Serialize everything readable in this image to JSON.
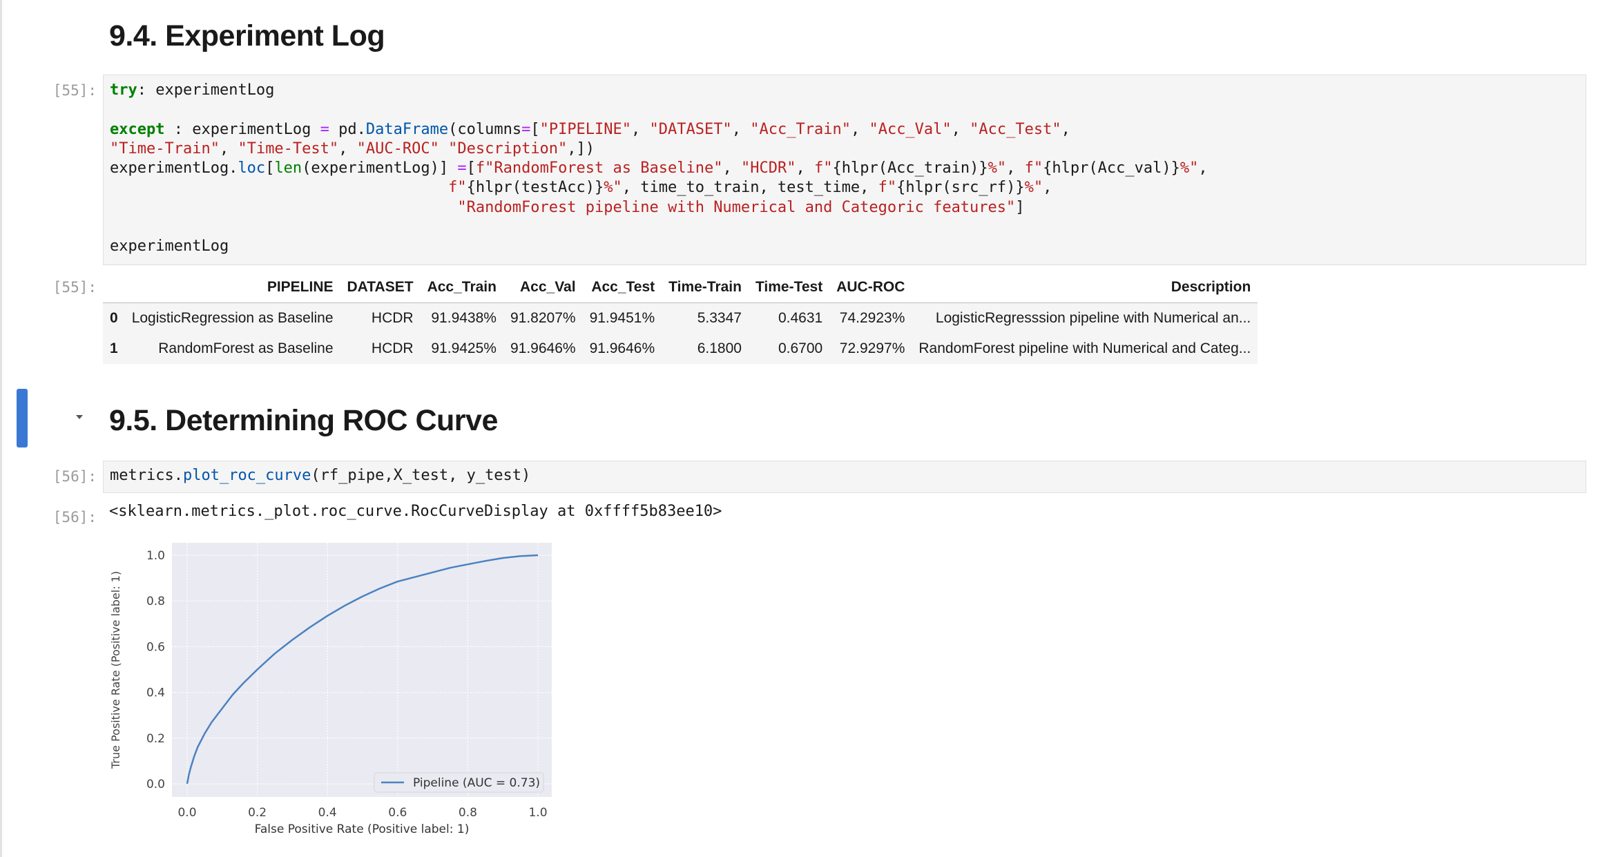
{
  "sections": {
    "experiment_log_heading": "9.4. Experiment Log",
    "roc_heading": "9.5. Determining ROC Curve"
  },
  "cells": {
    "cell55_prompt": "[55]:",
    "cell55_out_prompt": "[55]:",
    "cell56_prompt": "[56]:",
    "cell56_out_prompt": "[56]:",
    "cell56_output_text": "<sklearn.metrics._plot.roc_curve.RocCurveDisplay at 0xffff5b83ee10>"
  },
  "code55": {
    "l1_kw": "try",
    "l1_rest": ": experimentLog",
    "l3_kw": "except",
    "l3_a": " : experimentLog ",
    "l3_eq": "=",
    "l3_b": " pd.",
    "l3_fn": "DataFrame",
    "l3_c": "(columns",
    "l3_eq2": "=",
    "l3_d": "[",
    "l3_s1": "\"PIPELINE\"",
    "l3_e": ", ",
    "l3_s2": "\"DATASET\"",
    "l3_f": ", ",
    "l3_s3": "\"Acc_Train\"",
    "l3_g": ", ",
    "l3_s4": "\"Acc_Val\"",
    "l3_h": ", ",
    "l3_s5": "\"Acc_Test\"",
    "l3_i": ",",
    "l4_s1": "\"Time-Train\"",
    "l4_a": ", ",
    "l4_s2": "\"Time-Test\"",
    "l4_b": ", ",
    "l4_s3": "\"AUC-ROC\" \"Description\"",
    "l4_c": ",])",
    "l5_a": "experimentLog.",
    "l5_fn": "loc",
    "l5_b": "[",
    "l5_bi": "len",
    "l5_c": "(experimentLog)] ",
    "l5_eq": "=",
    "l5_d": "[",
    "l5_s1": "f\"RandomForest as Baseline\"",
    "l5_e": ", ",
    "l5_s2": "\"HCDR\"",
    "l5_f": ", ",
    "l5_s3": "f\"",
    "l5_g": "{hlpr(Acc_train)}",
    "l5_s4": "%\"",
    "l5_h": ", ",
    "l5_s5": "f\"",
    "l5_i": "{hlpr(Acc_val)}",
    "l5_s6": "%\"",
    "l5_j": ",",
    "l6_indent": "                                     ",
    "l6_s1": "f\"",
    "l6_a": "{hlpr(testAcc)}",
    "l6_s2": "%\"",
    "l6_b": ", time_to_train, test_time, ",
    "l6_s3": "f\"",
    "l6_c": "{hlpr(src_rf)}",
    "l6_s4": "%\"",
    "l6_d": ",",
    "l7_indent": "                                      ",
    "l7_s1": "\"RandomForest pipeline with Numerical and Categoric features\"",
    "l7_a": "]",
    "l9": "experimentLog"
  },
  "code56": {
    "a": "metrics.",
    "fn": "plot_roc_curve",
    "b": "(rf_pipe,X_test, y_test)"
  },
  "table": {
    "columns": [
      "",
      "PIPELINE",
      "DATASET",
      "Acc_Train",
      "Acc_Val",
      "Acc_Test",
      "Time-Train",
      "Time-Test",
      "AUC-ROC",
      "Description"
    ],
    "rows": [
      [
        "0",
        "LogisticRegression as Baseline",
        "HCDR",
        "91.9438%",
        "91.8207%",
        "91.9451%",
        "5.3347",
        "0.4631",
        "74.2923%",
        "LogisticRegresssion pipeline with Numerical an..."
      ],
      [
        "1",
        "RandomForest as Baseline",
        "HCDR",
        "91.9425%",
        "91.9646%",
        "91.9646%",
        "6.1800",
        "0.6700",
        "72.9297%",
        "RandomForest pipeline with Numerical and Categ..."
      ]
    ]
  },
  "chart_data": {
    "type": "line",
    "title": "",
    "xlabel": "False Positive Rate (Positive label: 1)",
    "ylabel": "True Positive Rate (Positive label: 1)",
    "xlim": [
      0.0,
      1.0
    ],
    "ylim": [
      0.0,
      1.0
    ],
    "xticks": [
      "0.0",
      "0.2",
      "0.4",
      "0.6",
      "0.8",
      "1.0"
    ],
    "yticks": [
      "0.0",
      "0.2",
      "0.4",
      "0.6",
      "0.8",
      "1.0"
    ],
    "grid": true,
    "legend_position": "lower-right",
    "series": [
      {
        "name": "Pipeline (AUC = 0.73)",
        "color": "#4a82c0",
        "x": [
          0.0,
          0.005,
          0.01,
          0.02,
          0.03,
          0.05,
          0.07,
          0.1,
          0.13,
          0.16,
          0.2,
          0.25,
          0.3,
          0.35,
          0.4,
          0.45,
          0.5,
          0.55,
          0.6,
          0.65,
          0.7,
          0.75,
          0.8,
          0.85,
          0.9,
          0.95,
          1.0
        ],
        "y": [
          0.0,
          0.04,
          0.07,
          0.12,
          0.16,
          0.22,
          0.27,
          0.33,
          0.39,
          0.44,
          0.5,
          0.57,
          0.63,
          0.685,
          0.735,
          0.78,
          0.82,
          0.855,
          0.885,
          0.905,
          0.925,
          0.945,
          0.96,
          0.975,
          0.988,
          0.996,
          1.0
        ]
      }
    ]
  }
}
